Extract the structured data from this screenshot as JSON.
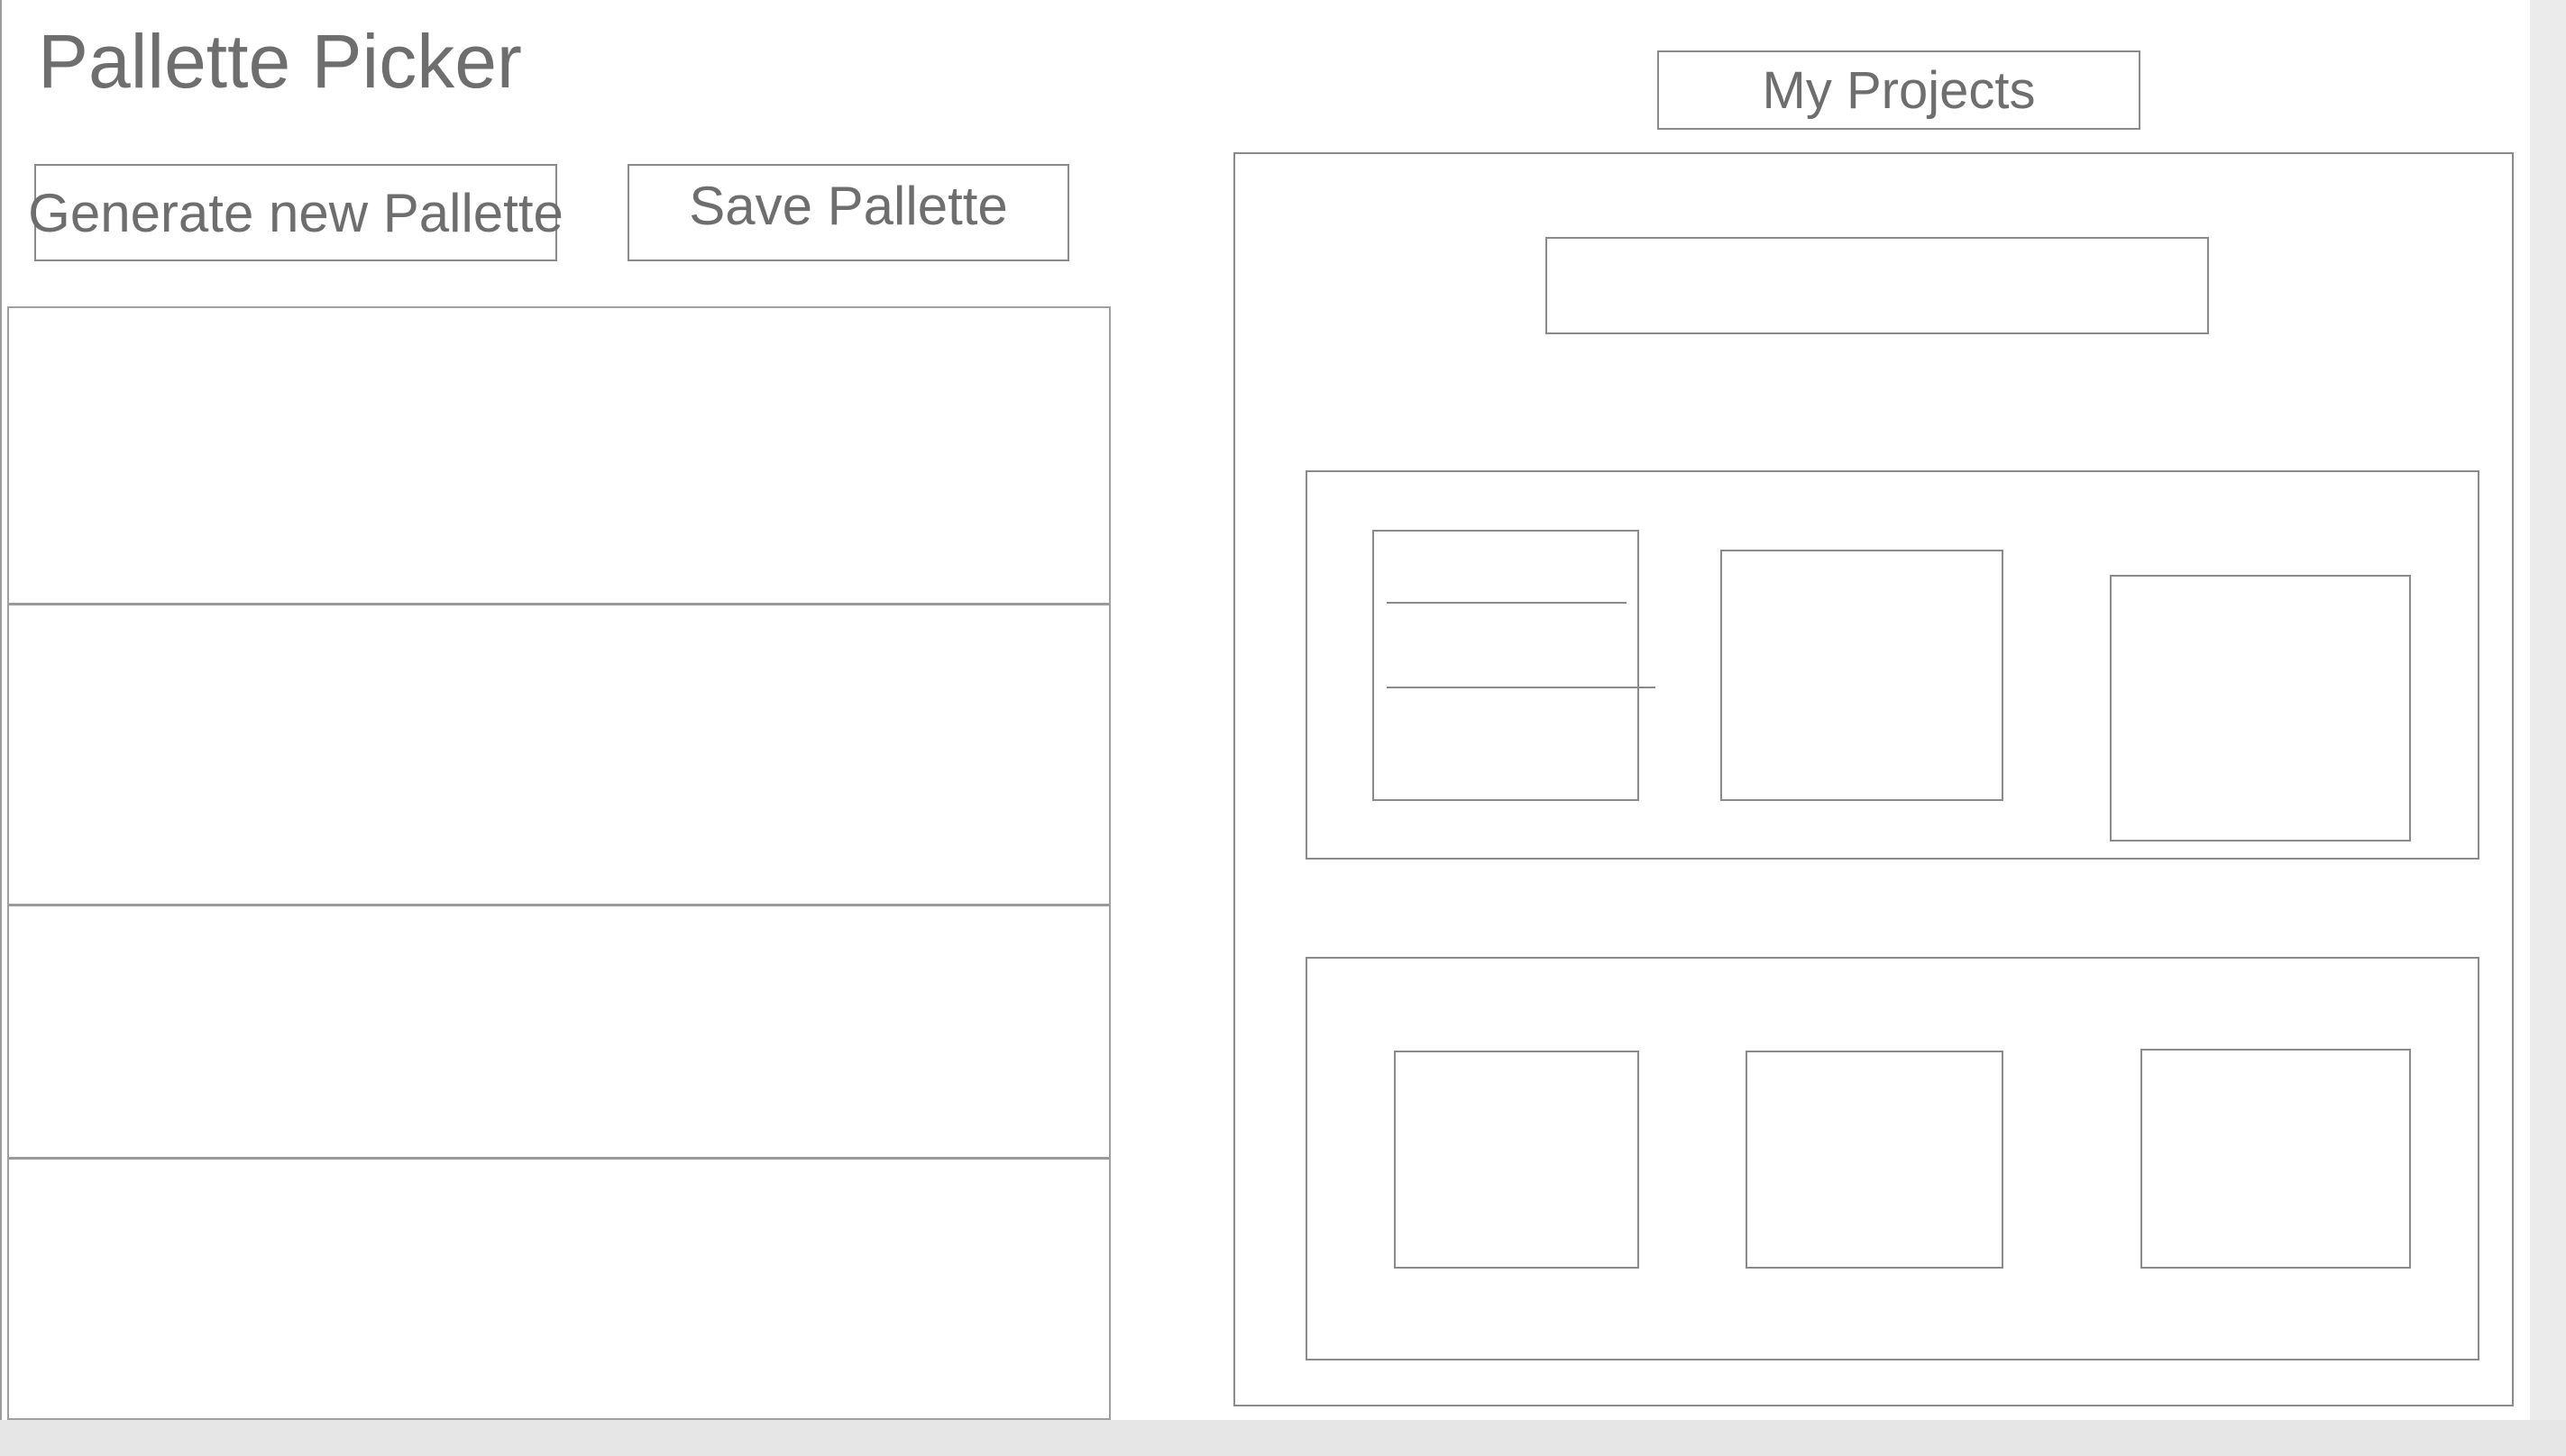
{
  "app": {
    "title": "Pallette Picker"
  },
  "toolbar": {
    "generate_label": "Generate new Pallette",
    "save_label": "Save Pallette",
    "projects_label": "My Projects"
  },
  "palette": {
    "swatch_count": 4
  },
  "projects": {
    "name_input_value": "",
    "cards": [
      {
        "thumbnails": 3
      },
      {
        "thumbnails": 3
      }
    ]
  },
  "colors": {
    "text": "#6e6e6e",
    "border": "#8a8a8a",
    "background": "#ffffff",
    "chrome": "#e6e6e6"
  }
}
